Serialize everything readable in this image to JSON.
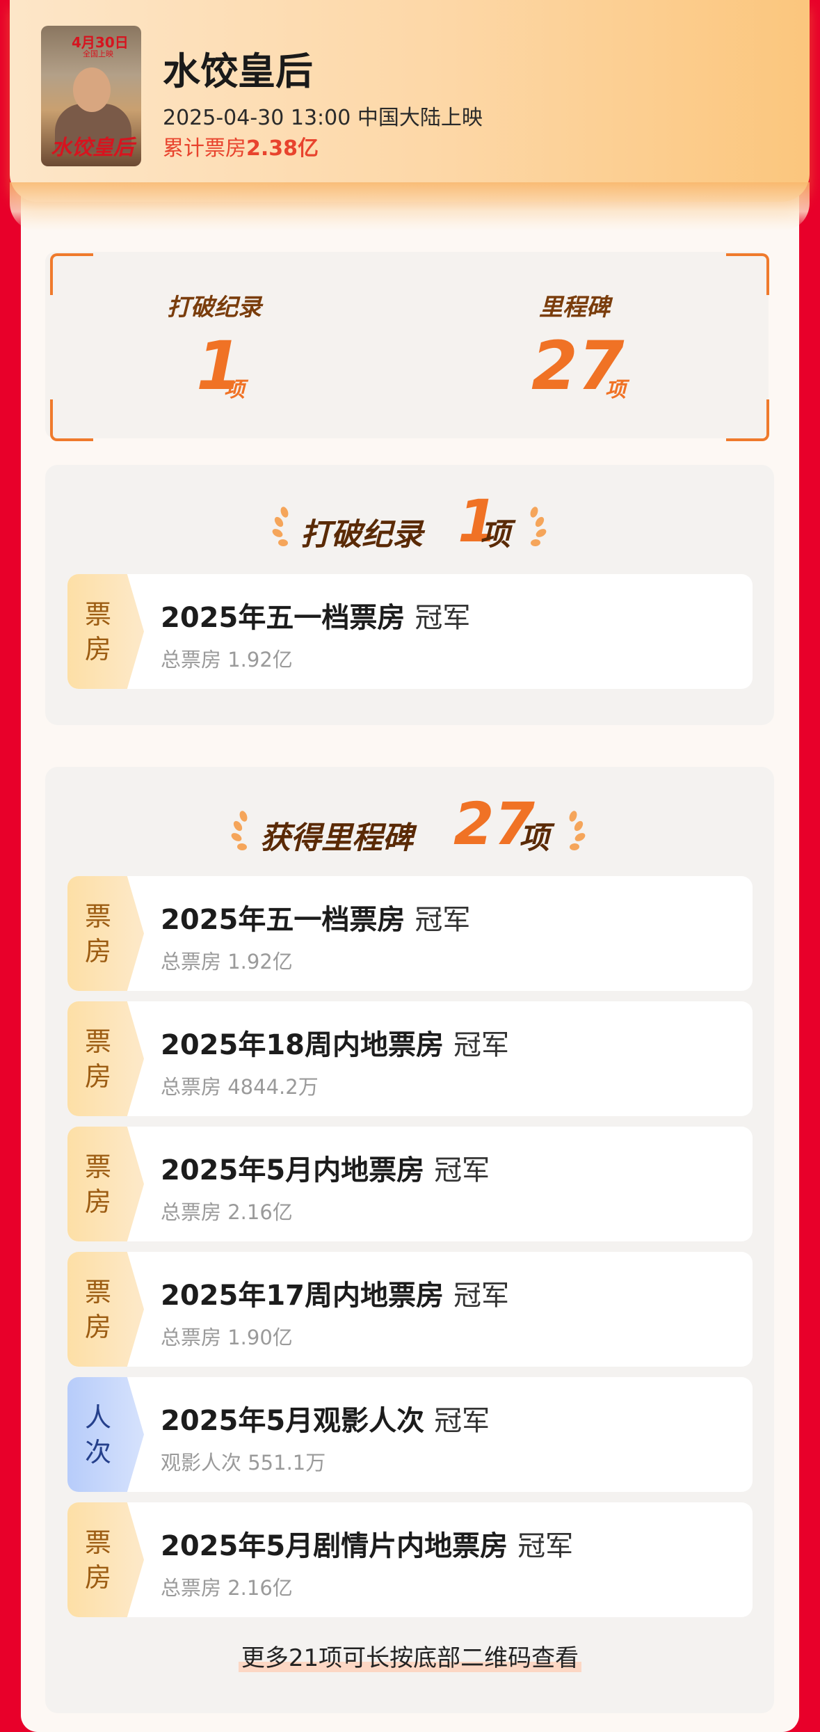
{
  "movie": {
    "title": "水饺皇后",
    "release": "2025-04-30 13:00 中国大陆上映",
    "boxoffice_prefix": "累计票房",
    "boxoffice_value": "2.38亿",
    "poster": {
      "date": "4月30日",
      "sub": "全国上映",
      "title": "水饺皇后"
    }
  },
  "summary": {
    "records_label": "打破纪录",
    "records_count": "1",
    "records_unit": "项",
    "milestones_label": "里程碑",
    "milestones_count": "27",
    "milestones_unit": "项"
  },
  "records_section": {
    "title": "打破纪录",
    "count": "1",
    "unit": "项",
    "items": [
      {
        "tag": [
          "票",
          "房"
        ],
        "tag_color": "gold",
        "title": "2025年五一档票房",
        "rank": "冠军",
        "sub": "总票房 1.92亿"
      }
    ]
  },
  "milestones_section": {
    "title": "获得里程碑",
    "count": "27",
    "unit": "项",
    "items": [
      {
        "tag": [
          "票",
          "房"
        ],
        "tag_color": "gold",
        "title": "2025年五一档票房",
        "rank": "冠军",
        "sub": "总票房 1.92亿"
      },
      {
        "tag": [
          "票",
          "房"
        ],
        "tag_color": "gold",
        "title": "2025年18周内地票房",
        "rank": "冠军",
        "sub": "总票房 4844.2万"
      },
      {
        "tag": [
          "票",
          "房"
        ],
        "tag_color": "gold",
        "title": "2025年5月内地票房",
        "rank": "冠军",
        "sub": "总票房 2.16亿"
      },
      {
        "tag": [
          "票",
          "房"
        ],
        "tag_color": "gold",
        "title": "2025年17周内地票房",
        "rank": "冠军",
        "sub": "总票房 1.90亿"
      },
      {
        "tag": [
          "人",
          "次"
        ],
        "tag_color": "blue",
        "title": "2025年5月观影人次",
        "rank": "冠军",
        "sub": "观影人次 551.1万"
      },
      {
        "tag": [
          "票",
          "房"
        ],
        "tag_color": "gold",
        "title": "2025年5月剧情片内地票房",
        "rank": "冠军",
        "sub": "总票房 2.16亿"
      }
    ],
    "more_text": "更多21项可长按底部二维码查看"
  },
  "colors": {
    "background": "#e8002a",
    "accent": "#f07225",
    "title_brown": "#5a2a06"
  }
}
